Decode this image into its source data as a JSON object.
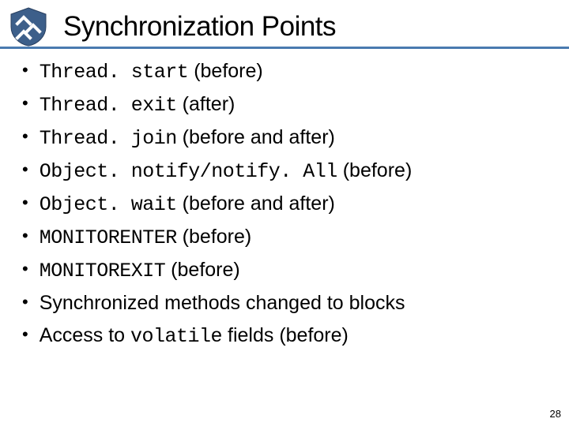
{
  "title": "Synchronization Points",
  "icon": "shield-chevrons-icon",
  "bullets": [
    {
      "code": "Thread. start",
      "suffix": " (before)"
    },
    {
      "code": "Thread. exit",
      "suffix": " (after)"
    },
    {
      "code": "Thread. join",
      "suffix": " (before and after)"
    },
    {
      "code": "Object. notify/notify. All",
      "suffix": " (before)"
    },
    {
      "code": "Object. wait",
      "suffix": " (before and after)"
    },
    {
      "code": "MONITORENTER",
      "suffix": " (before)"
    },
    {
      "code": "MONITOREXIT",
      "suffix": " (before)"
    },
    {
      "prefix": "Synchronized methods changed to blocks"
    },
    {
      "prefix": "Access to ",
      "code": "volatile",
      "suffix": " fields (before)"
    }
  ],
  "page": "28"
}
